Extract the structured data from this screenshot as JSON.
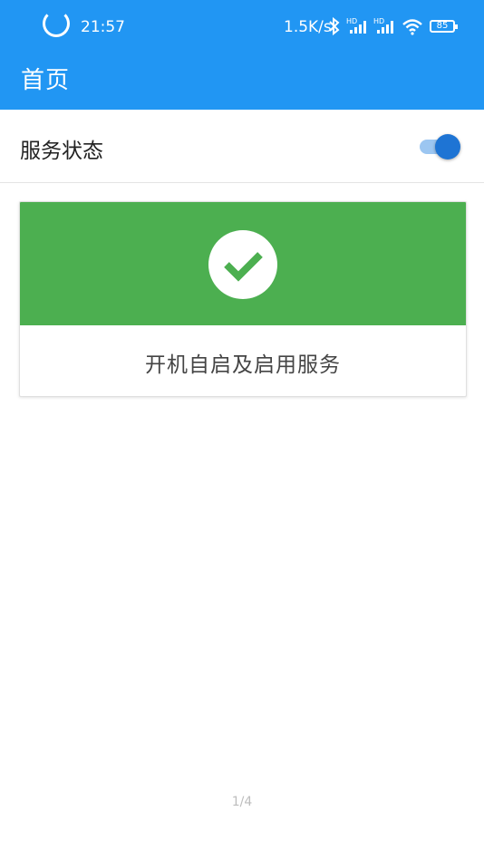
{
  "status_bar": {
    "time": "21:57",
    "network_speed": "1.5K/s",
    "battery": "85",
    "signal_badge": "HD",
    "icons": [
      "loading-spinner-icon",
      "bluetooth-icon",
      "signal-hd-icon",
      "signal-hd-icon",
      "wifi-icon",
      "battery-icon"
    ]
  },
  "app_bar": {
    "title": "首页",
    "color": "#2196F3"
  },
  "service_row": {
    "label": "服务状态",
    "switch_on": true,
    "switch_color": "#1E74D4"
  },
  "card": {
    "caption": "开机自启及启用服务",
    "banner_color": "#4CAF50",
    "icon": "check-circle-icon"
  },
  "pager": {
    "text": "1/4"
  }
}
